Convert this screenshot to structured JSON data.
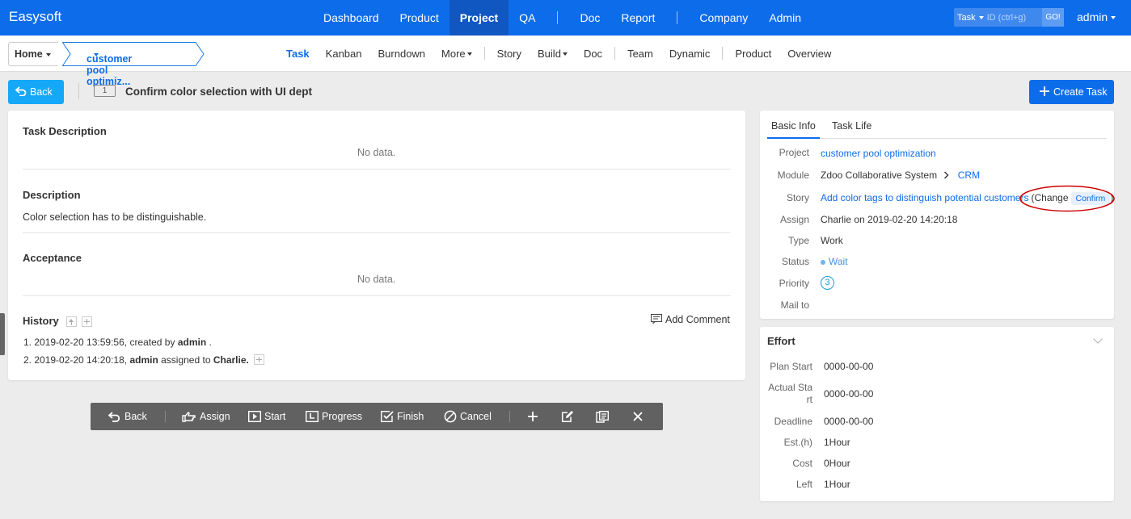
{
  "brand": "Easysoft",
  "mainnav": {
    "items": [
      "Dashboard",
      "Product",
      "Project",
      "QA",
      "Doc",
      "Report",
      "Company",
      "Admin"
    ],
    "active": "Project"
  },
  "search": {
    "type_label": "Task",
    "placeholder": "ID (ctrl+g)",
    "go_label": "GO!"
  },
  "user": {
    "name": "admin"
  },
  "breadcrumb": {
    "home": "Home",
    "project": "customer pool optimiz..."
  },
  "subnav": {
    "items": [
      "Task",
      "Kanban",
      "Burndown",
      "More",
      "Story",
      "Build",
      "Doc",
      "Team",
      "Dynamic",
      "Product",
      "Overview"
    ],
    "active": "Task"
  },
  "header": {
    "back_label": "Back",
    "task_id": "1",
    "task_title": "Confirm color selection with UI dept",
    "create_label": "Create Task"
  },
  "left": {
    "task_description_title": "Task Description",
    "task_description_value": "No data.",
    "description_title": "Description",
    "description_value": "Color selection has to be distinguishable.",
    "acceptance_title": "Acceptance",
    "acceptance_value": "No data.",
    "history_title": "History",
    "add_comment_label": "Add Comment",
    "history": [
      {
        "prefix": "1. 2019-02-20 13:59:56, created by ",
        "actor": "admin",
        "suffix": " ."
      },
      {
        "prefix": "2. 2019-02-20 14:20:18, ",
        "actor": "admin",
        "mid": " assigned to ",
        "target": "Charlie."
      }
    ]
  },
  "toolbar": {
    "back": "Back",
    "assign": "Assign",
    "start": "Start",
    "progress": "Progress",
    "finish": "Finish",
    "cancel": "Cancel"
  },
  "basic_info": {
    "tab_basic": "Basic Info",
    "tab_life": "Task Life",
    "labels": {
      "project": "Project",
      "module": "Module",
      "story": "Story",
      "assign": "Assign",
      "type": "Type",
      "status": "Status",
      "priority": "Priority",
      "mailto": "Mail to"
    },
    "project": "customer pool optimization",
    "module_parent": "Zdoo Collaborative System",
    "module_child": "CRM",
    "story": "Add color tags to distinguish potential customers",
    "story_change": "(Change",
    "story_confirm": "Confirm",
    "story_close": ")",
    "assign": "Charlie on 2019-02-20 14:20:18",
    "type": "Work",
    "status": "Wait",
    "priority": "3",
    "mailto": ""
  },
  "effort": {
    "title": "Effort",
    "labels": {
      "plan_start": "Plan Start",
      "actual_start": "Actual Start",
      "deadline": "Deadline",
      "est": "Est.(h)",
      "cost": "Cost",
      "left": "Left"
    },
    "plan_start": "0000-00-00",
    "actual_start": "0000-00-00",
    "deadline": "0000-00-00",
    "est": "1Hour",
    "cost": "0Hour",
    "left": "1Hour"
  },
  "colors": {
    "primary": "#0d6cea",
    "back_button": "#16a8f8",
    "highlight_circle": "#cc0000"
  }
}
